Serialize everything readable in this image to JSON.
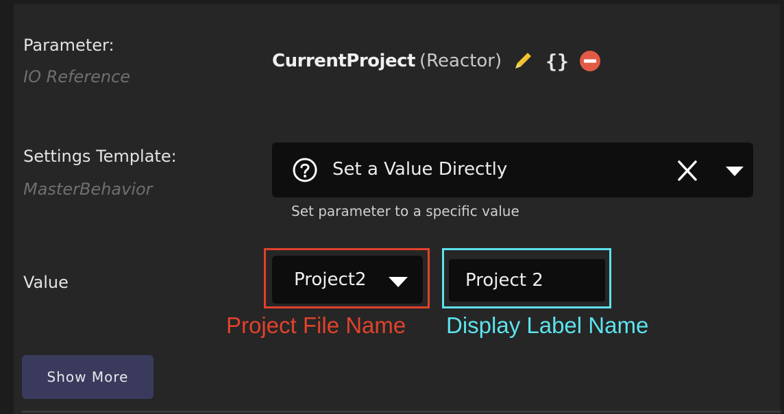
{
  "parameter": {
    "label": "Parameter:",
    "sub_label": "IO Reference",
    "value_name": "CurrentProject",
    "value_qualifier": "(Reactor)",
    "icons": {
      "edit": "pencil-icon",
      "expression": "braces-icon",
      "remove": "remove-circle-icon"
    },
    "braces_glyph": "{}"
  },
  "settings_template": {
    "label": "Settings Template:",
    "sub_label": "MasterBehavior",
    "selected": "Set a Value Directly",
    "description": "Set parameter to a specific value",
    "icons": {
      "help": "question-circle-icon",
      "clear": "close-icon",
      "dropdown": "chevron-down-icon"
    }
  },
  "value": {
    "label": "Value",
    "project_file_selected": "Project2",
    "display_label_value": "Project 2"
  },
  "annotations": {
    "project_file": "Project File Name",
    "display_label": "Display Label Name"
  },
  "show_more_label": "Show More",
  "colors": {
    "background": "#262626",
    "edit_icon": "#f2c230",
    "remove_icon": "#e25a45",
    "annotation_red": "#e2422c",
    "annotation_cyan": "#5de3ee",
    "show_more_bg": "#3a3b5c"
  }
}
